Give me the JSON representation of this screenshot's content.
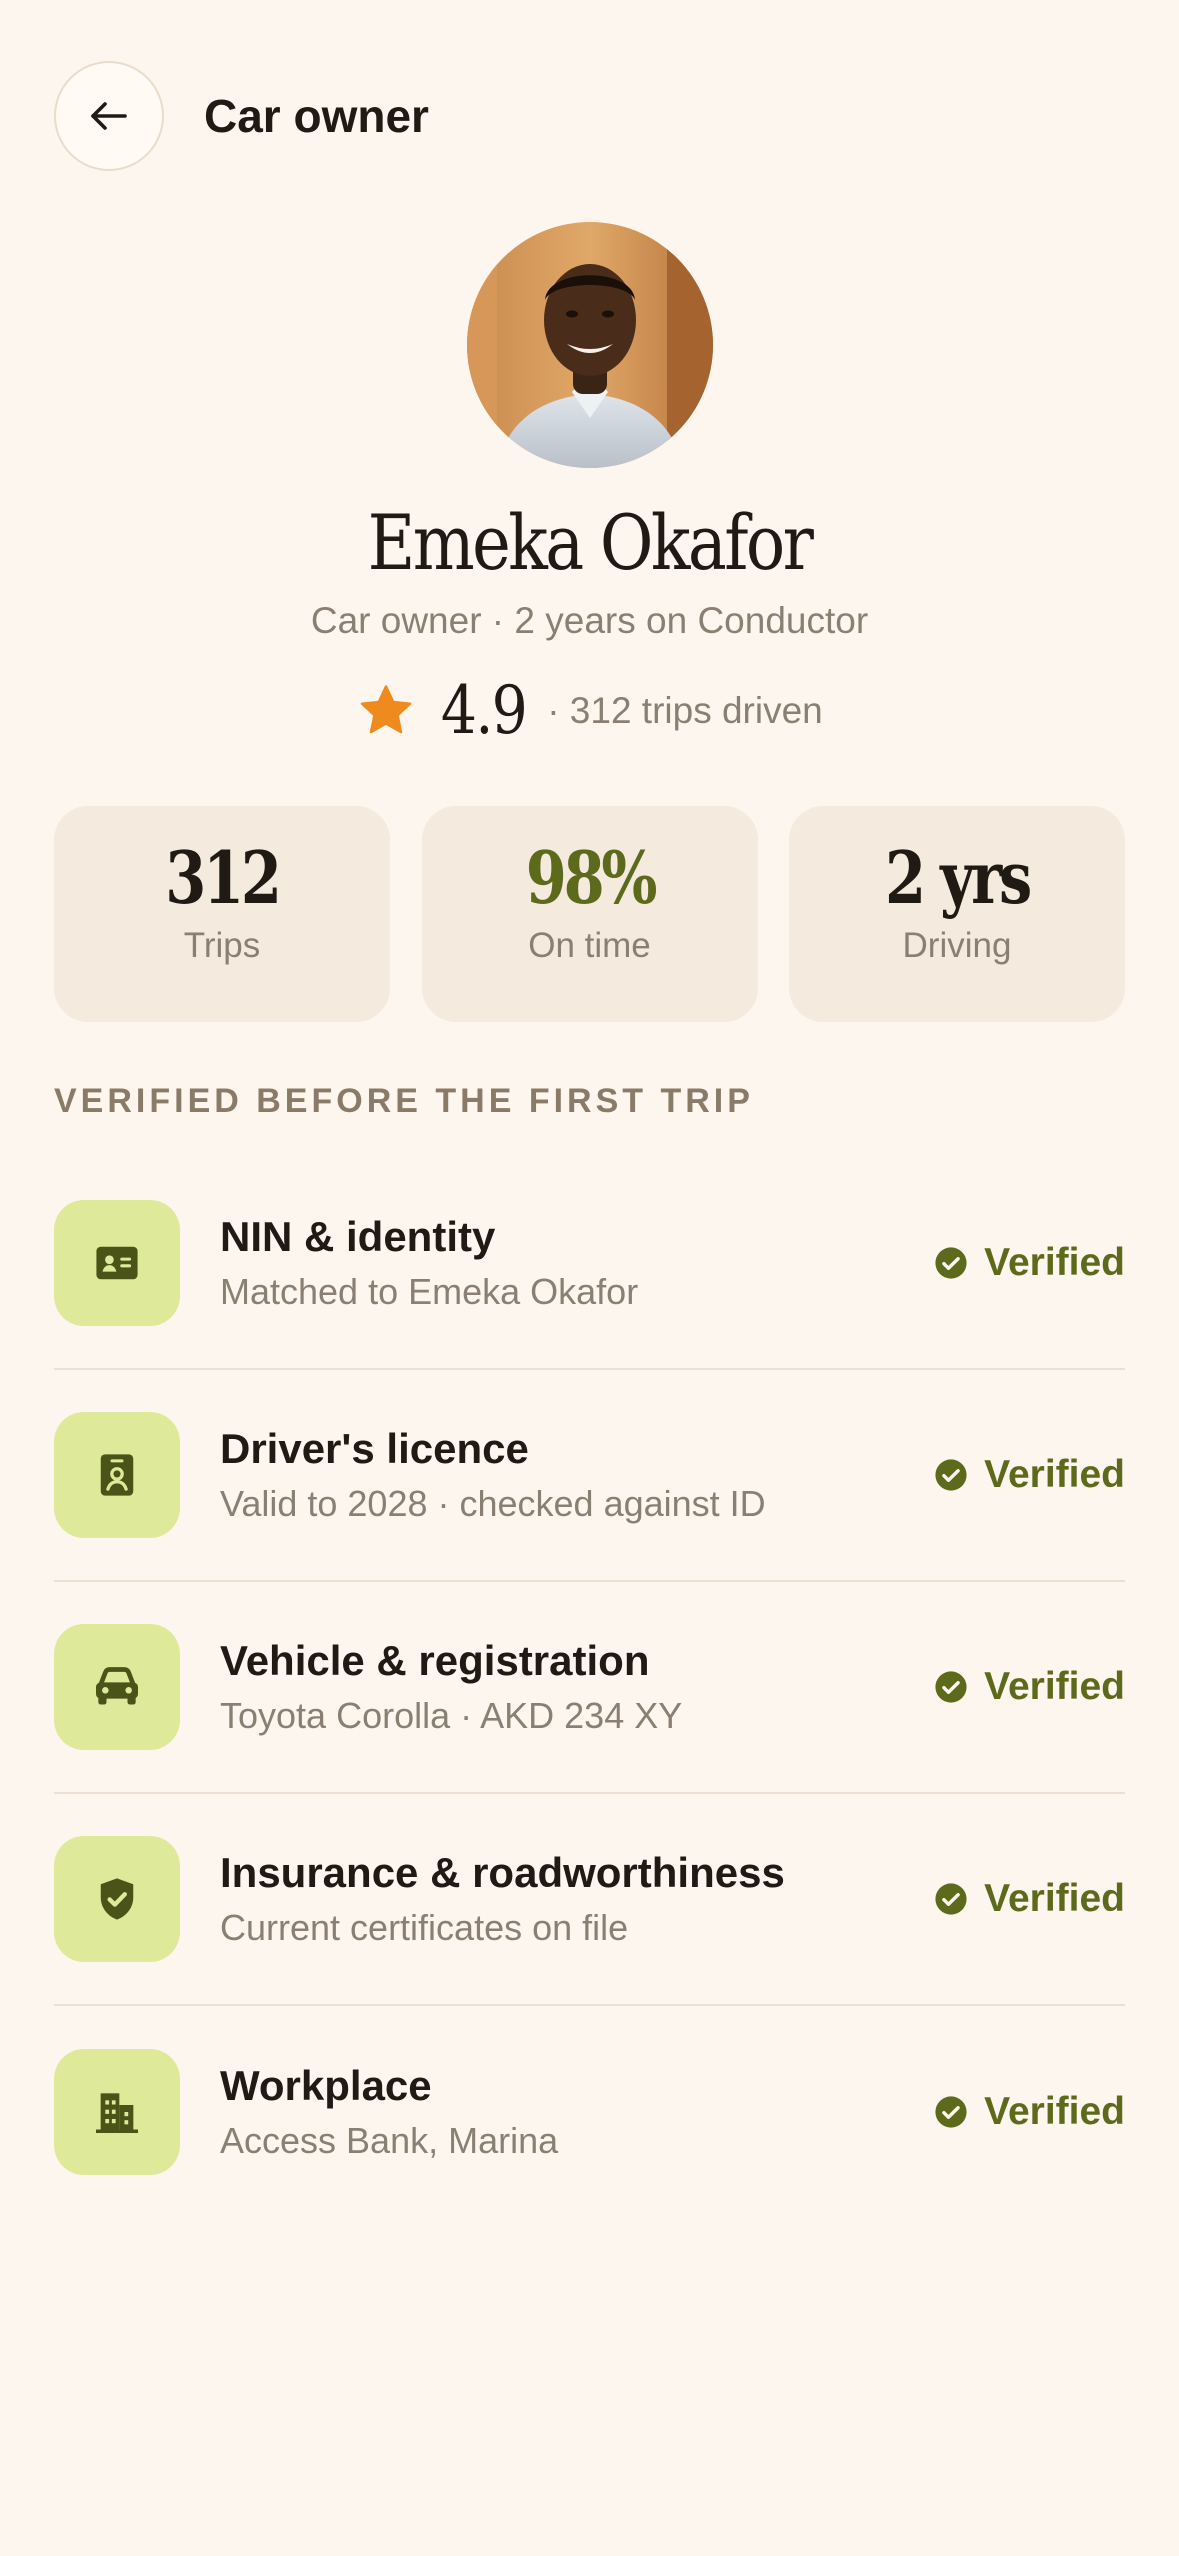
{
  "header": {
    "title": "Car owner",
    "back_icon": "arrow-left-icon"
  },
  "profile": {
    "name": "Emeka Okafor",
    "subtitle": "Car owner · 2 years on Conductor",
    "rating": "4.9",
    "trips_text": "· 312 trips driven",
    "star_color": "#ef8a1f"
  },
  "stats": [
    {
      "value": "312",
      "label": "Trips"
    },
    {
      "value": "98%",
      "label": "On time"
    },
    {
      "value": "2 yrs",
      "label": "Driving"
    }
  ],
  "verification": {
    "section_title": "VERIFIED BEFORE THE FIRST TRIP",
    "items": [
      {
        "title": "NIN & identity",
        "subtitle": "Matched to Emeka Okafor",
        "status": "Verified",
        "icon": "id-card-icon"
      },
      {
        "title": "Driver's licence",
        "subtitle": "Valid to 2028 · checked against ID",
        "status": "Verified",
        "icon": "licence-badge-icon"
      },
      {
        "title": "Vehicle & registration",
        "subtitle": "Toyota Corolla · AKD 234 XY",
        "status": "Verified",
        "icon": "car-icon"
      },
      {
        "title": "Insurance & roadworthiness",
        "subtitle": "Current certificates on file",
        "status": "Verified",
        "icon": "shield-check-icon"
      },
      {
        "title": "Workplace",
        "subtitle": "Access Bank, Marina",
        "status": "Verified",
        "icon": "building-icon"
      }
    ]
  },
  "colors": {
    "background": "#fdf6ee",
    "card": "#f4eadd",
    "accent": "#5d6a1c",
    "icon_tile": "#dfe99a",
    "muted_text": "#8a7f73"
  }
}
